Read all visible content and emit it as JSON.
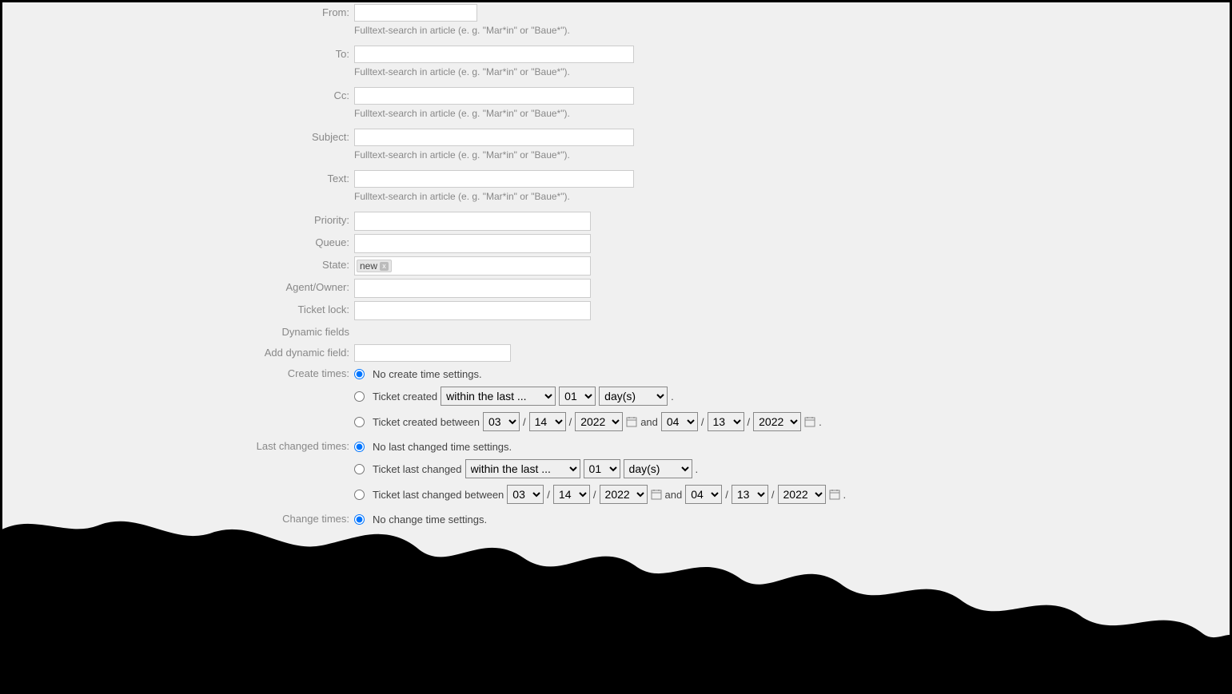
{
  "labels": {
    "from": "From:",
    "to": "To:",
    "cc": "Cc:",
    "subject": "Subject:",
    "text": "Text:",
    "priority": "Priority:",
    "queue": "Queue:",
    "state": "State:",
    "agent_owner": "Agent/Owner:",
    "ticket_lock": "Ticket lock:",
    "dynamic_fields": "Dynamic fields",
    "add_dynamic_field": "Add dynamic field:",
    "create_times": "Create times:",
    "last_changed_times": "Last changed times:",
    "change_times": "Change times:"
  },
  "hint": "Fulltext-search in article (e. g. \"Mar*in\" or \"Baue*\").",
  "state_tag": "new",
  "create": {
    "none": "No create time settings.",
    "created": "Ticket created",
    "between": "Ticket created between",
    "and": "and",
    "within": "within the last ...",
    "count": "01",
    "unit": "day(s)",
    "start": {
      "m": "03",
      "d": "14",
      "y": "2022"
    },
    "end": {
      "m": "04",
      "d": "13",
      "y": "2022"
    }
  },
  "lastchanged": {
    "none": "No last changed time settings.",
    "changed": "Ticket last changed",
    "between": "Ticket last changed between",
    "and": "and",
    "within": "within the last ...",
    "count": "01",
    "unit": "day(s)",
    "start": {
      "m": "03",
      "d": "14",
      "y": "2022"
    },
    "end": {
      "m": "04",
      "d": "13",
      "y": "2022"
    }
  },
  "change": {
    "none": "No change time settings."
  },
  "slash": "/",
  "dot": "."
}
